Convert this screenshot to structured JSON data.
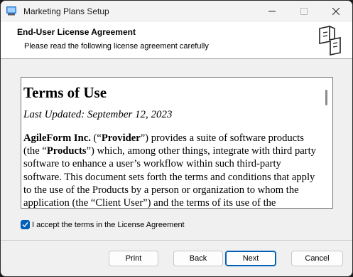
{
  "window": {
    "title": "Marketing Plans Setup"
  },
  "banner": {
    "title": "End-User License Agreement",
    "subtitle": "Please read the following license agreement carefully"
  },
  "license": {
    "heading": "Terms of Use",
    "updated": "Last Updated: September 12, 2023",
    "p1_a": "AgileForm Inc.",
    "p1_b": " (“",
    "p1_c": "Provider",
    "p1_d": "”) provides a suite of software products (the “",
    "p1_e": "Products",
    "p1_f": "”) which, among other things, integrate with third party software to enhance a user’s workflow within such third-party software. This document sets forth the terms and conditions that apply to the use of the Products by a person or organization to whom the application (the “Client User”) and the terms of its use of the"
  },
  "accept": {
    "label": "I accept the terms in the License Agreement",
    "checked": true
  },
  "buttons": {
    "print": "Print",
    "back": "Back",
    "next": "Next",
    "cancel": "Cancel"
  },
  "colors": {
    "accent": "#005fb8"
  }
}
